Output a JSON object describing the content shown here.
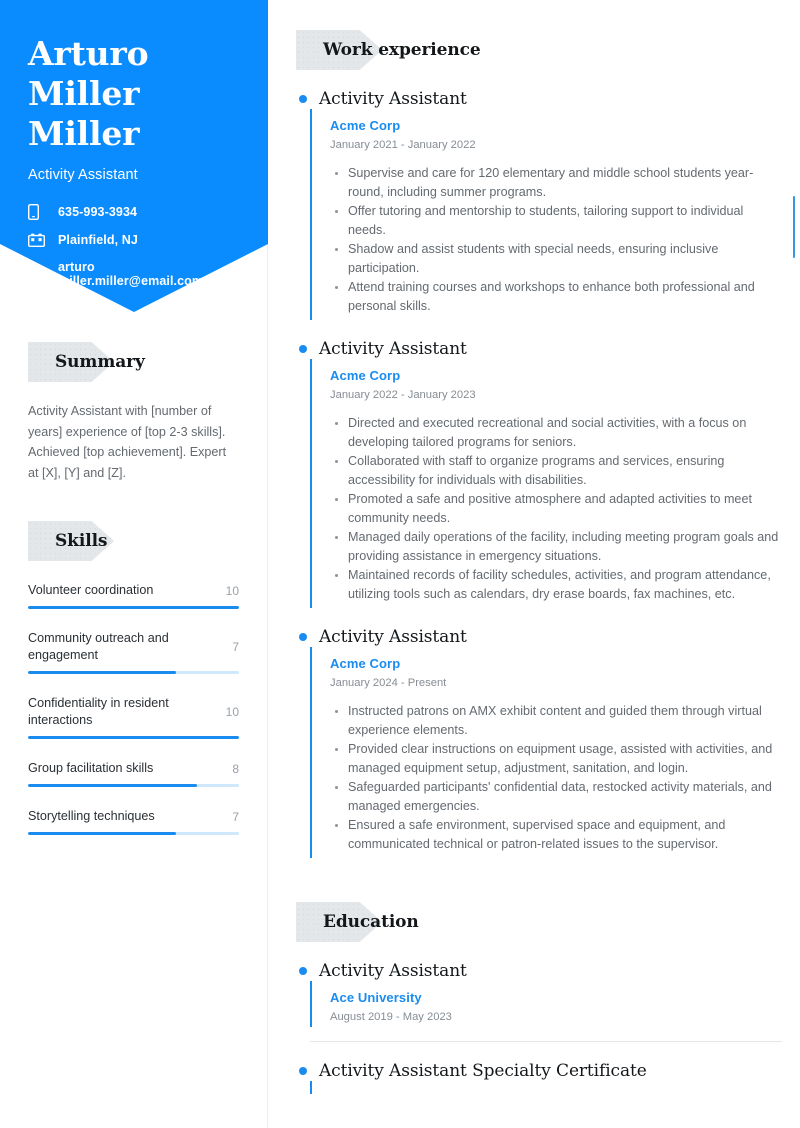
{
  "header": {
    "first_name": "Arturo",
    "last_name": "Miller Miller",
    "job_title": "Activity Assistant",
    "contacts": [
      {
        "icon": "phone-icon",
        "value": "635-993-3934"
      },
      {
        "icon": "location-building-icon",
        "value": "Plainfield, NJ"
      },
      {
        "icon": "envelope-icon",
        "value": "arturo miller.miller@email.com"
      }
    ]
  },
  "sidebar": {
    "summary": {
      "heading": "Summary",
      "text": "Activity Assistant with [number of years] experience of [top 2-3 skills]. Achieved [top achievement]. Expert at [X], [Y] and [Z]."
    },
    "skills": {
      "heading": "Skills",
      "max": 10,
      "items": [
        {
          "name": "Volunteer coordination",
          "score": "10",
          "value": 10
        },
        {
          "name": "Community outreach and engagement",
          "score": "7",
          "value": 7
        },
        {
          "name": "Confidentiality in resident interactions",
          "score": "10",
          "value": 10
        },
        {
          "name": "Group facilitation skills",
          "score": "8",
          "value": 8
        },
        {
          "name": "Storytelling techniques",
          "score": "7",
          "value": 7
        }
      ]
    }
  },
  "main": {
    "work": {
      "heading": "Work experience",
      "entries": [
        {
          "title": "Activity Assistant",
          "org": "Acme Corp",
          "dates": "January 2021 - January 2022",
          "bullets": [
            "Supervise and care for 120 elementary and middle school students year-round, including summer programs.",
            "Offer tutoring and mentorship to students, tailoring support to individual needs.",
            "Shadow and assist students with special needs, ensuring inclusive participation.",
            "Attend training courses and workshops to enhance both professional and personal skills."
          ]
        },
        {
          "title": "Activity Assistant",
          "org": "Acme Corp",
          "dates": "January 2022 - January 2023",
          "bullets": [
            "Directed and executed recreational and social activities, with a focus on developing tailored programs for seniors.",
            "Collaborated with staff to organize programs and services, ensuring accessibility for individuals with disabilities.",
            "Promoted a safe and positive atmosphere and adapted activities to meet community needs.",
            "Managed daily operations of the facility, including meeting program goals and providing assistance in emergency situations.",
            "Maintained records of facility schedules, activities, and program attendance, utilizing tools such as calendars, dry erase boards, fax machines, etc."
          ]
        },
        {
          "title": "Activity Assistant",
          "org": "Acme Corp",
          "dates": "January 2024 - Present",
          "bullets": [
            "Instructed patrons on AMX exhibit content and guided them through virtual experience elements.",
            "Provided clear instructions on equipment usage, assisted with activities, and managed equipment setup, adjustment, sanitation, and login.",
            "Safeguarded participants' confidential data, restocked activity materials, and managed emergencies.",
            "Ensured a safe environment, supervised space and equipment, and communicated technical or patron-related issues to the supervisor."
          ]
        }
      ]
    },
    "education": {
      "heading": "Education",
      "entries": [
        {
          "title": "Activity Assistant",
          "org": "Ace University",
          "dates": "August 2019 - May 2023"
        },
        {
          "title": "Activity Assistant Specialty Certificate",
          "org": "",
          "dates": ""
        }
      ]
    }
  },
  "colors": {
    "accent_blue": "#0a8cff",
    "link_blue": "#1a8cf0",
    "track_blue": "#cfe8fb",
    "tag_gray": "#e4e7e9",
    "body_text": "#646a70"
  }
}
